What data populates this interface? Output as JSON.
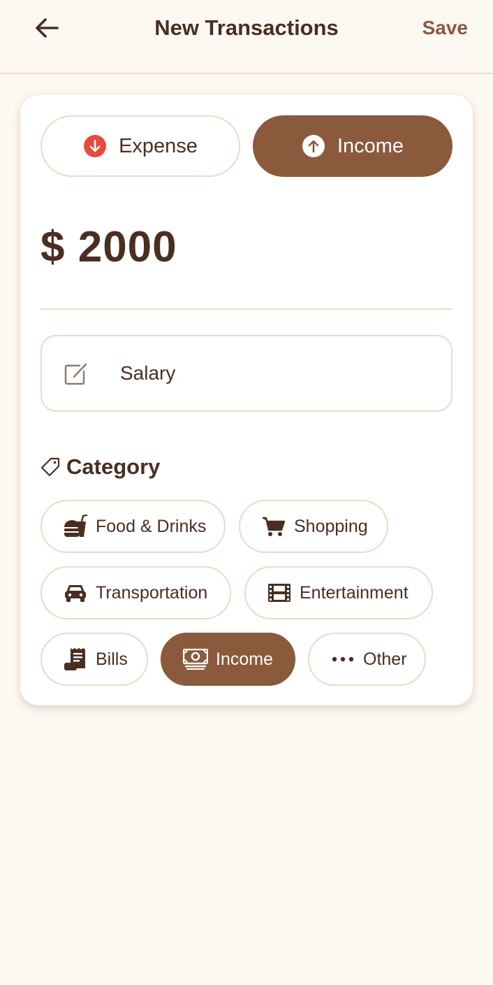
{
  "header": {
    "title": "New Transactions",
    "save_label": "Save",
    "back_icon": "arrow-left-icon"
  },
  "transaction_type": {
    "expense_label": "Expense",
    "income_label": "Income",
    "selected": "Income",
    "expense_icon": "arrow-down-circle-icon",
    "income_icon": "arrow-up-circle-icon"
  },
  "amount": {
    "display": "$ 2000"
  },
  "note": {
    "value": "Salary",
    "icon": "edit-icon"
  },
  "category": {
    "title": "Category",
    "icon": "tag-icon",
    "selected": "Income",
    "items": [
      {
        "label": "Food & Drinks",
        "icon": "food-icon"
      },
      {
        "label": "Shopping",
        "icon": "cart-icon"
      },
      {
        "label": "Transportation",
        "icon": "car-icon"
      },
      {
        "label": "Entertainment",
        "icon": "film-icon"
      },
      {
        "label": "Bills",
        "icon": "receipt-icon"
      },
      {
        "label": "Income",
        "icon": "money-icon"
      },
      {
        "label": "Other",
        "icon": "more-dots-icon"
      }
    ]
  },
  "colors": {
    "accent": "#8b5a3c",
    "text": "#4a2e1f",
    "background": "#fdf8f2",
    "border": "#e8dcc4",
    "expense_red": "#e84a3c"
  }
}
